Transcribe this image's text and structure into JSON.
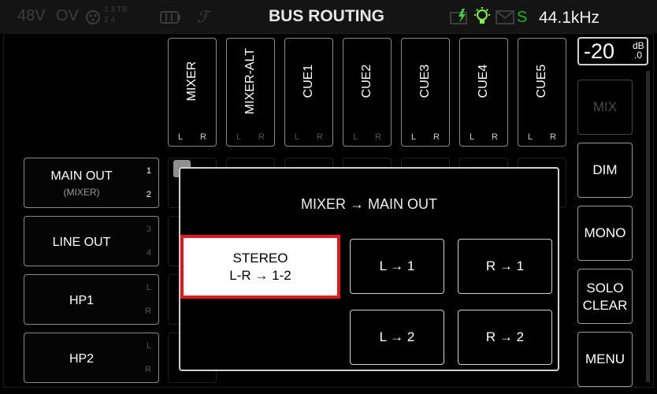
{
  "header": {
    "phantom": "48V",
    "ov": "OV",
    "inputs_top": "1 3 TB",
    "inputs_bottom": "2 4",
    "title": "BUS ROUTING",
    "status_letter": "S",
    "sample_rate": "44.1kHz"
  },
  "level": {
    "value": "-20",
    "unit_top": "dB",
    "unit_bottom": ".0"
  },
  "columns": [
    {
      "label": "MIXER",
      "l": "L",
      "r": "R"
    },
    {
      "label": "MIXER-ALT",
      "l": "L",
      "r": "R"
    },
    {
      "label": "CUE1",
      "l": "L",
      "r": "R"
    },
    {
      "label": "CUE2",
      "l": "L",
      "r": "R"
    },
    {
      "label": "CUE3",
      "l": "L",
      "r": "R"
    },
    {
      "label": "CUE4",
      "l": "L",
      "r": "R"
    },
    {
      "label": "CUE5",
      "l": "L",
      "r": "R"
    }
  ],
  "rows": [
    {
      "name": "MAIN OUT",
      "sub": "(MIXER)",
      "ch1": "1",
      "ch2": "2"
    },
    {
      "name": "LINE OUT",
      "sub": "",
      "ch1": "3",
      "ch2": "4"
    },
    {
      "name": "HP1",
      "sub": "",
      "ch1": "L",
      "ch2": "R"
    },
    {
      "name": "HP2",
      "sub": "",
      "ch1": "L",
      "ch2": "R"
    }
  ],
  "right_buttons": {
    "mix": "MIX",
    "dim": "DIM",
    "mono": "MONO",
    "solo1": "SOLO",
    "solo2": "CLEAR",
    "menu": "MENU"
  },
  "dialog": {
    "title": "MIXER → MAIN OUT",
    "stereo_line1": "STEREO",
    "stereo_line2": "L-R → 1-2",
    "l1": "L → 1",
    "r1": "R → 1",
    "l2": "L → 2",
    "r2": "R → 2"
  },
  "colors": {
    "selection": "#e0191f",
    "status_green": "#1fb21f",
    "bolt": "#3fd23f",
    "bulb": "#7cff3a"
  }
}
